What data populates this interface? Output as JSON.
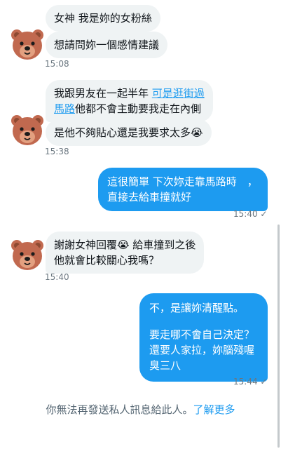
{
  "conversation": {
    "group1": {
      "messages": [
        "女神 我是妳的女粉絲",
        "想請問妳一個感情建議"
      ],
      "time": "15:08"
    },
    "group2": {
      "message1": {
        "line1_prefix": "我跟男友在一起半年",
        "line1_link": "可是逛街過",
        "line2_link": "馬路",
        "line2_suffix": "他都不會主動要我走在內側"
      },
      "message2": "是他不夠貼心還是我要求太多😭",
      "time": "15:38"
    },
    "reply1": {
      "lines": [
        "這很簡單 下次妳走靠馬路時　，",
        "直接去給車撞就好"
      ],
      "time": "15:40",
      "status": "✓"
    },
    "group3": {
      "lines": [
        "謝謝女神回覆😭 給車撞到之後",
        "他就會比較關心我嗎？"
      ],
      "time": "15:40"
    },
    "reply2": {
      "line1": "不，是讓妳清醒點。",
      "line2": "要走哪不會自己決定？",
      "line3": "還要人家拉，妳腦殘喔",
      "line4": "臭三八",
      "time": "15:44",
      "status": "✓"
    }
  },
  "footer": {
    "notice": "你無法再發送私人訊息給此人。",
    "link": "了解更多"
  },
  "colors": {
    "incoming_bubble": "#eff3f4",
    "outgoing_bubble": "#1d9bf0",
    "link": "#1d9bf0",
    "avatar": "bear-face"
  }
}
